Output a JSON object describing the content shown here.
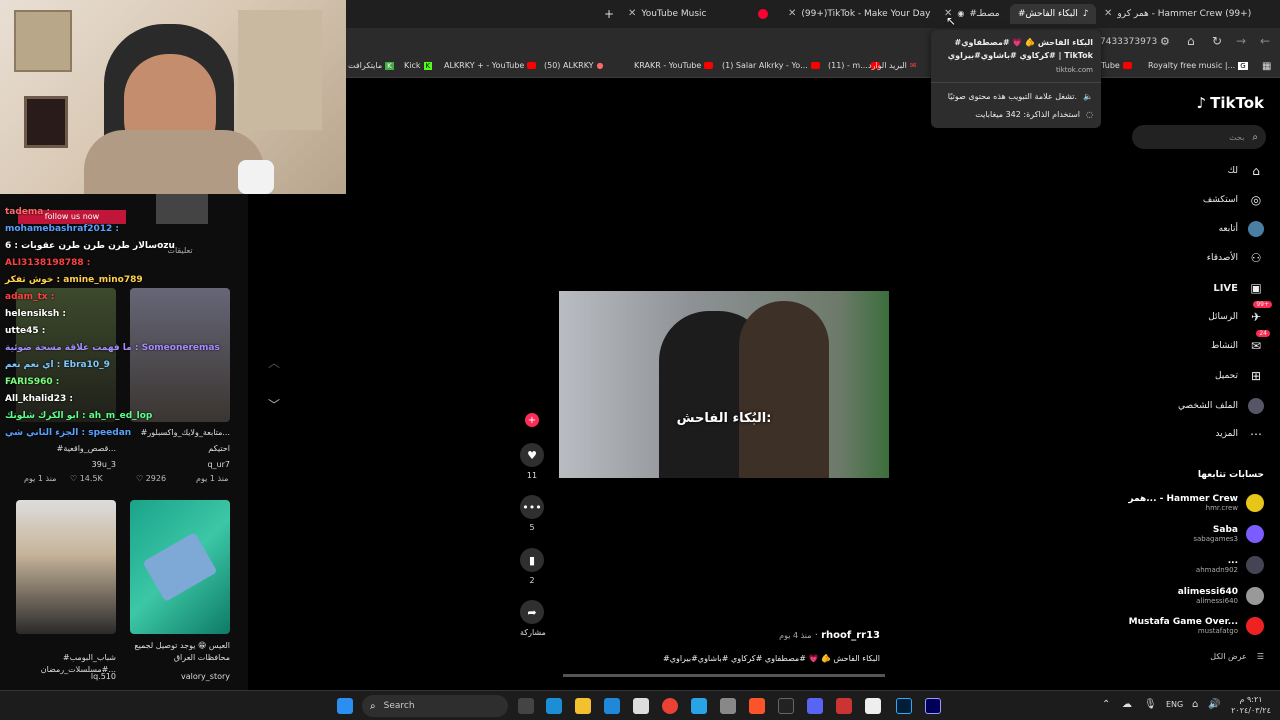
{
  "browser": {
    "tabs": [
      {
        "label": "YouTube Music",
        "active": false
      },
      {
        "label": "(99+)TikTok - Make Your Day",
        "active": false
      },
      {
        "label": "#مصطـ",
        "active": false
      },
      {
        "label": "#البكاء الفاحش",
        "active": true
      },
      {
        "label": "همر كرو - Hammer Crew (99+)",
        "active": false
      }
    ],
    "new_tab": "+",
    "address_partial": "7433373973",
    "bookmarks": [
      "مايتكرافت",
      "Kick",
      "ALKRKY + - YouTube",
      "(50) ALKRKY",
      "KRAKR - YouTube",
      "(1) Salar Alkrky - Yo...",
      "(11) - m...",
      "البريد الوارد",
      "uTube",
      "Royalty free music |..."
    ],
    "tooltip": {
      "title": "#البكاء الفاحش 🫵 💗 #مصطفاوي #كركاوي #باشاوي#بيراوي | TikTok",
      "domain": "tiktok.com",
      "line1": "تشغل علامة التبويب هذه محتوى صوتيًا.",
      "line2": "استخدام الذاكرة: 342 ميغابايت"
    }
  },
  "chat": {
    "follow_banner": "follow us now",
    "lines": [
      {
        "text": "tadema :",
        "color": "#ff6b6b"
      },
      {
        "text": "mohamebashraf2012 :",
        "color": "#5aa0ff"
      },
      {
        "text": "سالار طرن طرن طرن عقوبات : 6ozu",
        "color": "#ffffff"
      },
      {
        "text": "ALI3138198788 :",
        "color": "#ff4040"
      },
      {
        "text": "خوش تفكر : amine_mino789",
        "color": "#ffd24a"
      },
      {
        "text": "adam_tx :",
        "color": "#ff4040"
      },
      {
        "text": "helensiksh :",
        "color": "#ffffff"
      },
      {
        "text": "utte45 :",
        "color": "#ffffff"
      },
      {
        "text": "ما فهمت علاقة مسحة ضوئية : Someoneremas",
        "color": "#a58cff"
      },
      {
        "text": "اي نعم نعم : Ebra10_9",
        "color": "#7ec8ff"
      },
      {
        "text": "FARIS960 :",
        "color": "#7cff7c"
      },
      {
        "text": "All_khalid23 :",
        "color": "#ffffff"
      },
      {
        "text": "ابو الكرك شلونك : ah_m_ed_lop",
        "color": "#5aff8a"
      },
      {
        "text": "الجزء الثاني شي : speedan",
        "color": "#5aa0ff"
      }
    ],
    "grid": {
      "tab_label": "تعليقات",
      "cards": [
        {
          "caption": "#متابعة_ولايك_واكسبلور...",
          "sub": "احتيكم",
          "user": "q_ur7",
          "meta": "منذ 1 يوم",
          "likes": "2926"
        },
        {
          "caption": "#قصص_واقعية...",
          "sub": "",
          "user": "39u_3",
          "meta": "منذ 1 يوم",
          "likes": "14.5K"
        },
        {
          "caption": "العيس 😁 يوجد توصيل لجميع محافظات العراق",
          "sub": "",
          "user": "valory_story",
          "meta": "",
          "likes": ""
        },
        {
          "caption": "#شباب_البومب #مسلسلات_رمضان...",
          "sub": "",
          "user": "lq.510",
          "meta": "",
          "likes": ""
        }
      ]
    }
  },
  "tiktok": {
    "logo": "TikTok",
    "search_placeholder": "بحث",
    "nav": [
      {
        "label": "لك",
        "icon": "home-icon",
        "glyph": "⌂"
      },
      {
        "label": "استكشف",
        "icon": "compass-icon",
        "glyph": "◎"
      },
      {
        "label": "أتابعه",
        "icon": "following-avatar-icon",
        "glyph": "●"
      },
      {
        "label": "الأصدقاء",
        "icon": "friends-icon",
        "glyph": "👥"
      },
      {
        "label": "LIVE",
        "icon": "live-icon",
        "glyph": "▶"
      },
      {
        "label": "الرسائل",
        "icon": "messages-icon",
        "glyph": "✈",
        "badge": "99+"
      },
      {
        "label": "النشاط",
        "icon": "activity-icon",
        "glyph": "✉",
        "badge": "24"
      },
      {
        "label": "تحميل",
        "icon": "upload-icon",
        "glyph": "⊞"
      },
      {
        "label": "الملف الشخصي",
        "icon": "profile-icon",
        "glyph": "●"
      },
      {
        "label": "المزيد",
        "icon": "more-icon",
        "glyph": "⋯"
      }
    ],
    "following_title": "حسابات تتابعها",
    "accounts": [
      {
        "name": "همر... - Hammer Crew",
        "handle": "hmr.crew",
        "color": "#e6c619"
      },
      {
        "name": "Saba",
        "handle": "sabagames3",
        "color": "#7a5cff"
      },
      {
        "name": "...",
        "handle": "ahmadn902",
        "color": "#556"
      },
      {
        "name": "alimessi640",
        "handle": "alimessi640",
        "color": "#aaa"
      },
      {
        "name": "Mustafa Game Over...",
        "handle": "mustafatgo",
        "color": "#e22"
      }
    ],
    "see_all": "عرض الكل",
    "video": {
      "subtitle": "البُكاء الفاحش:",
      "author": "rhoof_rr13",
      "posted": "منذ 4 يوم",
      "caption": "#البكاء الفاحش 🫵 💗 #مصطفاوي #كركاوي #باشاوي#بيراوي"
    },
    "actions": {
      "likes": "11",
      "comments": "5",
      "saves": "2",
      "share": "مشاركة"
    }
  },
  "taskbar": {
    "search": "Search",
    "lang": "ENG",
    "time": "٩:٢١ م",
    "date": "٢٠٢٤/٠٣/٢٤"
  }
}
